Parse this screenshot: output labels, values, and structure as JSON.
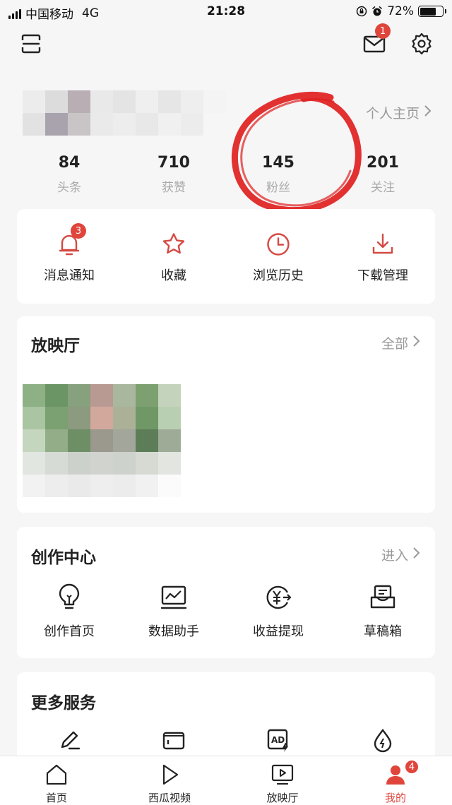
{
  "status_bar": {
    "carrier": "中国移动",
    "network": "4G",
    "time": "21:28",
    "battery": "72%",
    "battery_level": 0.72
  },
  "header": {
    "mail_badge": "1",
    "home_link": "个人主页"
  },
  "stats": [
    {
      "value": "84",
      "label": "头条"
    },
    {
      "value": "710",
      "label": "获赞"
    },
    {
      "value": "145",
      "label": "粉丝"
    },
    {
      "value": "201",
      "label": "关注"
    }
  ],
  "quick_actions": [
    {
      "label": "消息通知",
      "icon": "bell-icon",
      "badge": "3"
    },
    {
      "label": "收藏",
      "icon": "star-icon"
    },
    {
      "label": "浏览历史",
      "icon": "clock-icon"
    },
    {
      "label": "下载管理",
      "icon": "download-icon"
    }
  ],
  "cinema": {
    "title": "放映厅",
    "link": "全部"
  },
  "creation": {
    "title": "创作中心",
    "link": "进入",
    "items": [
      {
        "label": "创作首页",
        "icon": "lightbulb-icon"
      },
      {
        "label": "数据助手",
        "icon": "chart-monitor-icon"
      },
      {
        "label": "收益提现",
        "icon": "yuan-withdraw-icon"
      },
      {
        "label": "草稿箱",
        "icon": "draft-box-icon"
      }
    ]
  },
  "more_services": {
    "title": "更多服务",
    "items": [
      {
        "icon": "edit-pen-icon"
      },
      {
        "icon": "wallet-icon"
      },
      {
        "icon": "ad-flash-icon"
      },
      {
        "icon": "drop-icon"
      }
    ]
  },
  "tabbar": {
    "tabs": [
      {
        "label": "首页",
        "icon": "home-icon"
      },
      {
        "label": "西瓜视频",
        "icon": "play-icon"
      },
      {
        "label": "放映厅",
        "icon": "screen-play-icon"
      },
      {
        "label": "我的",
        "icon": "person-icon",
        "badge": "4",
        "active": true
      }
    ]
  },
  "colors": {
    "accent": "#e0453c",
    "annotation_red": "#e02020",
    "background": "#f6f6f6"
  }
}
